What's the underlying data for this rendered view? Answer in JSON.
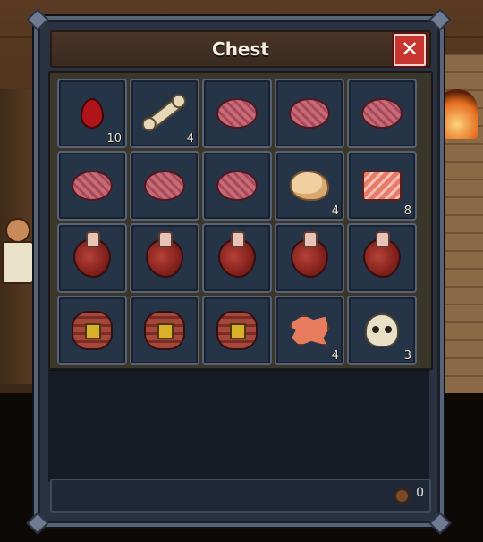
{
  "window": {
    "title": "Chest",
    "close_label": "✕"
  },
  "slots": [
    {
      "item": "blood-icon",
      "qty": "10"
    },
    {
      "item": "bone-icon",
      "qty": "4"
    },
    {
      "item": "brain-icon",
      "qty": ""
    },
    {
      "item": "brain-icon",
      "qty": ""
    },
    {
      "item": "brain-icon",
      "qty": ""
    },
    {
      "item": "brain-icon",
      "qty": ""
    },
    {
      "item": "brain-icon",
      "qty": ""
    },
    {
      "item": "brain-icon",
      "qty": ""
    },
    {
      "item": "fat-icon",
      "qty": "4"
    },
    {
      "item": "meat-icon",
      "qty": "8"
    },
    {
      "item": "heart-icon",
      "qty": ""
    },
    {
      "item": "heart-icon",
      "qty": ""
    },
    {
      "item": "heart-icon",
      "qty": ""
    },
    {
      "item": "heart-icon",
      "qty": ""
    },
    {
      "item": "heart-icon",
      "qty": ""
    },
    {
      "item": "intestines-icon",
      "qty": ""
    },
    {
      "item": "intestines-icon",
      "qty": ""
    },
    {
      "item": "intestines-icon",
      "qty": ""
    },
    {
      "item": "skin-icon",
      "qty": "4"
    },
    {
      "item": "skull-icon",
      "qty": "3"
    }
  ],
  "footer": {
    "coin_icon": "coin-icon",
    "coins": "0"
  },
  "colors": {
    "close_button": "#c8342f",
    "slot_bg": "#263447",
    "window_frame": "#596377"
  }
}
